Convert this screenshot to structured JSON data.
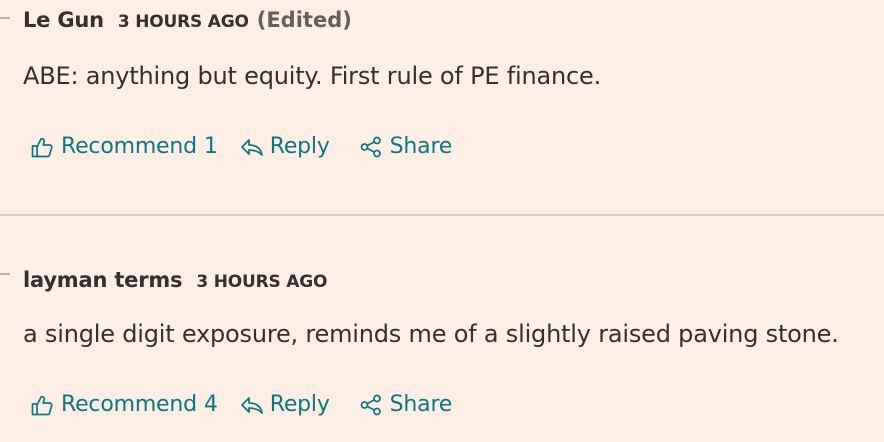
{
  "comments": [
    {
      "author": "Le Gun",
      "timestamp": "3 HOURS AGO",
      "edited": "(Edited)",
      "text": "ABE: anything but equity. First rule of PE finance.",
      "actions": {
        "recommend_label": "Recommend",
        "recommend_count": "1",
        "reply_label": "Reply",
        "share_label": "Share"
      }
    },
    {
      "author": "layman terms",
      "timestamp": "3 HOURS AGO",
      "text": "a single digit exposure, reminds me of a slightly raised paving stone.",
      "actions": {
        "recommend_label": "Recommend",
        "recommend_count": "4",
        "reply_label": "Reply",
        "share_label": "Share"
      }
    }
  ],
  "icons": {
    "recommend": "thumbs-up-icon",
    "reply": "reply-arrow-icon",
    "share": "share-icon"
  },
  "colors": {
    "background": "#fdefe5",
    "text": "#33302e",
    "muted": "#66605c",
    "link": "#0d7680",
    "divider": "#d5cfc8"
  }
}
